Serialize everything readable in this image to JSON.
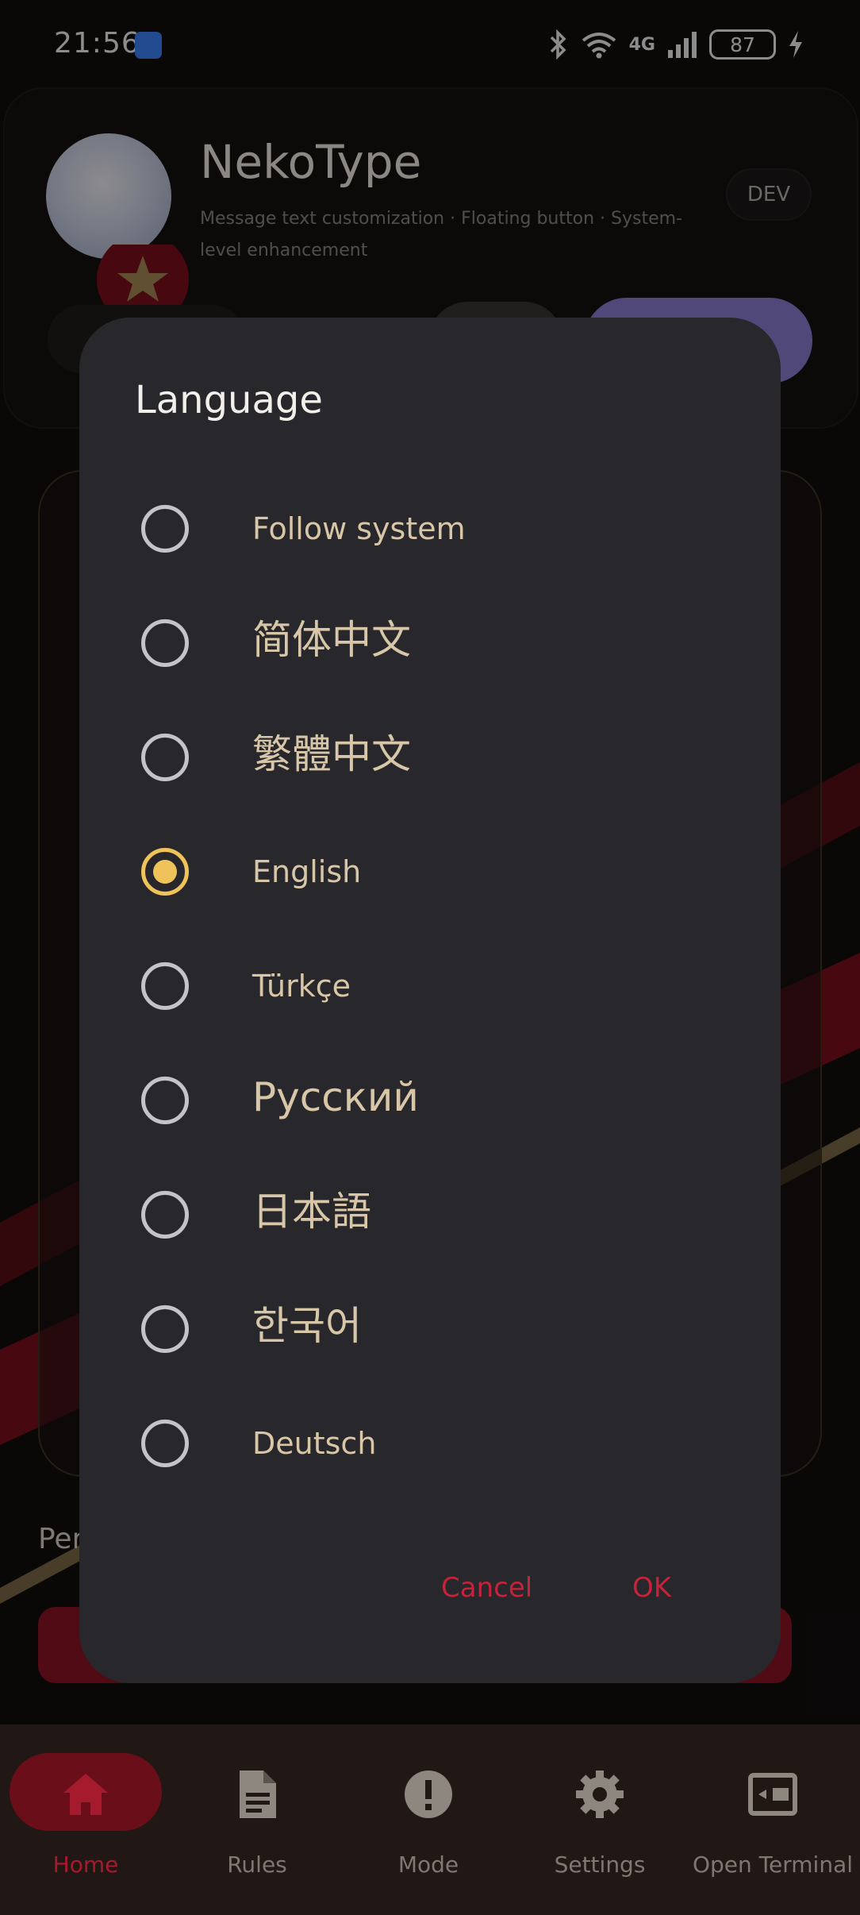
{
  "status_bar": {
    "time": "21:56",
    "network": "4G",
    "battery": "87"
  },
  "header": {
    "app_title": "NekoType",
    "subtitle": "Message text customization · Floating button · System-level enhancement",
    "badge": "DEV"
  },
  "background": {
    "section_label": "Per"
  },
  "dialog": {
    "title": "Language",
    "options": [
      {
        "label": "Follow system",
        "selected": false
      },
      {
        "label": "简体中文",
        "selected": false
      },
      {
        "label": "繁體中文",
        "selected": false
      },
      {
        "label": "English",
        "selected": true
      },
      {
        "label": "Türkçe",
        "selected": false
      },
      {
        "label": "Русский",
        "selected": false
      },
      {
        "label": "日本語",
        "selected": false
      },
      {
        "label": "한국어",
        "selected": false
      },
      {
        "label": "Deutsch",
        "selected": false
      }
    ],
    "cancel_label": "Cancel",
    "ok_label": "OK"
  },
  "bottom_nav": {
    "items": [
      {
        "label": "Home",
        "icon": "home-icon",
        "active": true
      },
      {
        "label": "Rules",
        "icon": "document-icon",
        "active": false
      },
      {
        "label": "Mode",
        "icon": "alert-icon",
        "active": false
      },
      {
        "label": "Settings",
        "icon": "gear-icon",
        "active": false
      },
      {
        "label": "Open Terminal",
        "icon": "terminal-icon",
        "active": false
      }
    ]
  },
  "colors": {
    "accent_red": "#c4233b",
    "selected_yellow": "#f0c35a",
    "dialog_bg": "#28282c"
  }
}
